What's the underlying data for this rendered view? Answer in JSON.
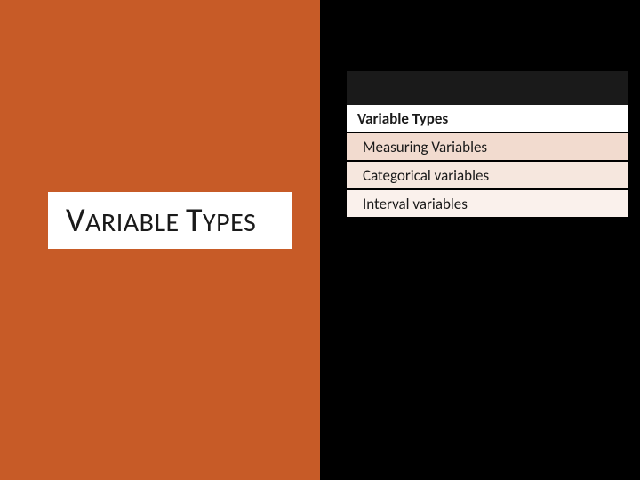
{
  "left": {
    "title_html_parts": [
      "V",
      "ARIABLE ",
      "T",
      "YPES"
    ]
  },
  "right": {
    "heading": "Variable Types",
    "items": [
      "Measuring Variables",
      "Categorical variables",
      "Interval variables"
    ]
  }
}
